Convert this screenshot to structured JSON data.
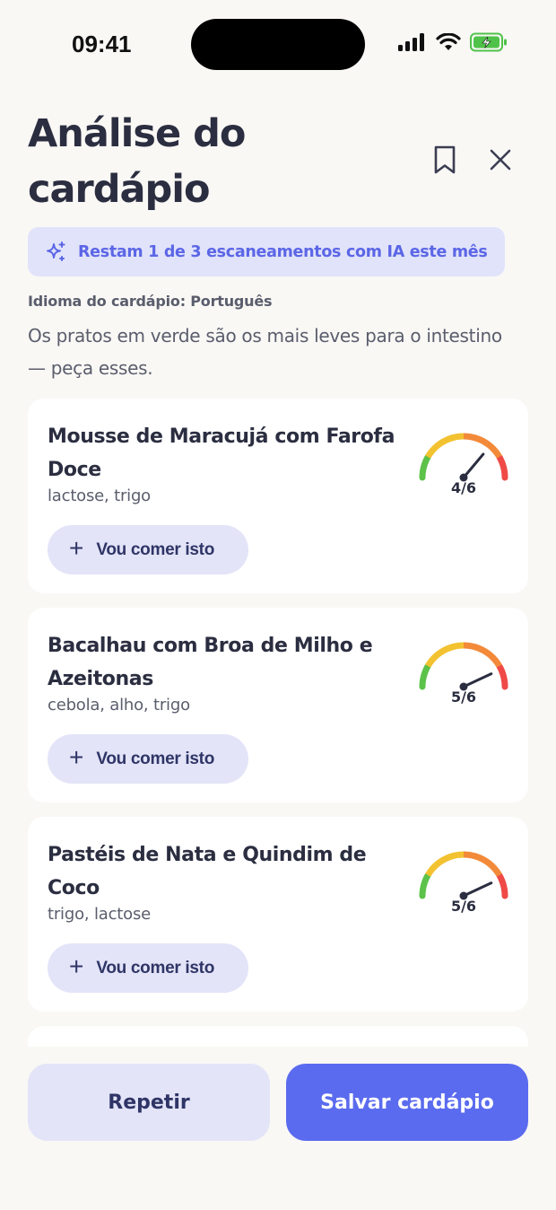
{
  "status_bar": {
    "time": "09:41"
  },
  "header": {
    "title": "Análise do cardápio"
  },
  "ai_banner": {
    "text": "Restam 1 de 3 escaneamentos com IA este mês"
  },
  "menu_language": "Idioma do cardápio: Português",
  "hint": "Os pratos em verde são os mais leves para o intestino — peça esses.",
  "dishes": [
    {
      "name": "Mousse de Maracujá com Farofa Doce",
      "allergens": "lactose, trigo",
      "score_label": "4/6",
      "score": 4,
      "score_max": 6,
      "action_label": "Vou comer isto"
    },
    {
      "name": "Bacalhau com Broa de Milho e Azeitonas",
      "allergens": "cebola, alho, trigo",
      "score_label": "5/6",
      "score": 5,
      "score_max": 6,
      "action_label": "Vou comer isto"
    },
    {
      "name": "Pastéis de Nata e Quindim de Coco",
      "allergens": "trigo, lactose",
      "score_label": "5/6",
      "score": 5,
      "score_max": 6,
      "action_label": "Vou comer isto"
    }
  ],
  "footer": {
    "repeat_label": "Repetir",
    "save_label": "Salvar cardápio"
  },
  "colors": {
    "accent": "#5b6bef",
    "banner_text": "#5b66e6",
    "gauge_green": "#5cc24a",
    "gauge_yellow": "#f2c230",
    "gauge_orange": "#f28a3a",
    "gauge_red": "#ef4a47"
  }
}
